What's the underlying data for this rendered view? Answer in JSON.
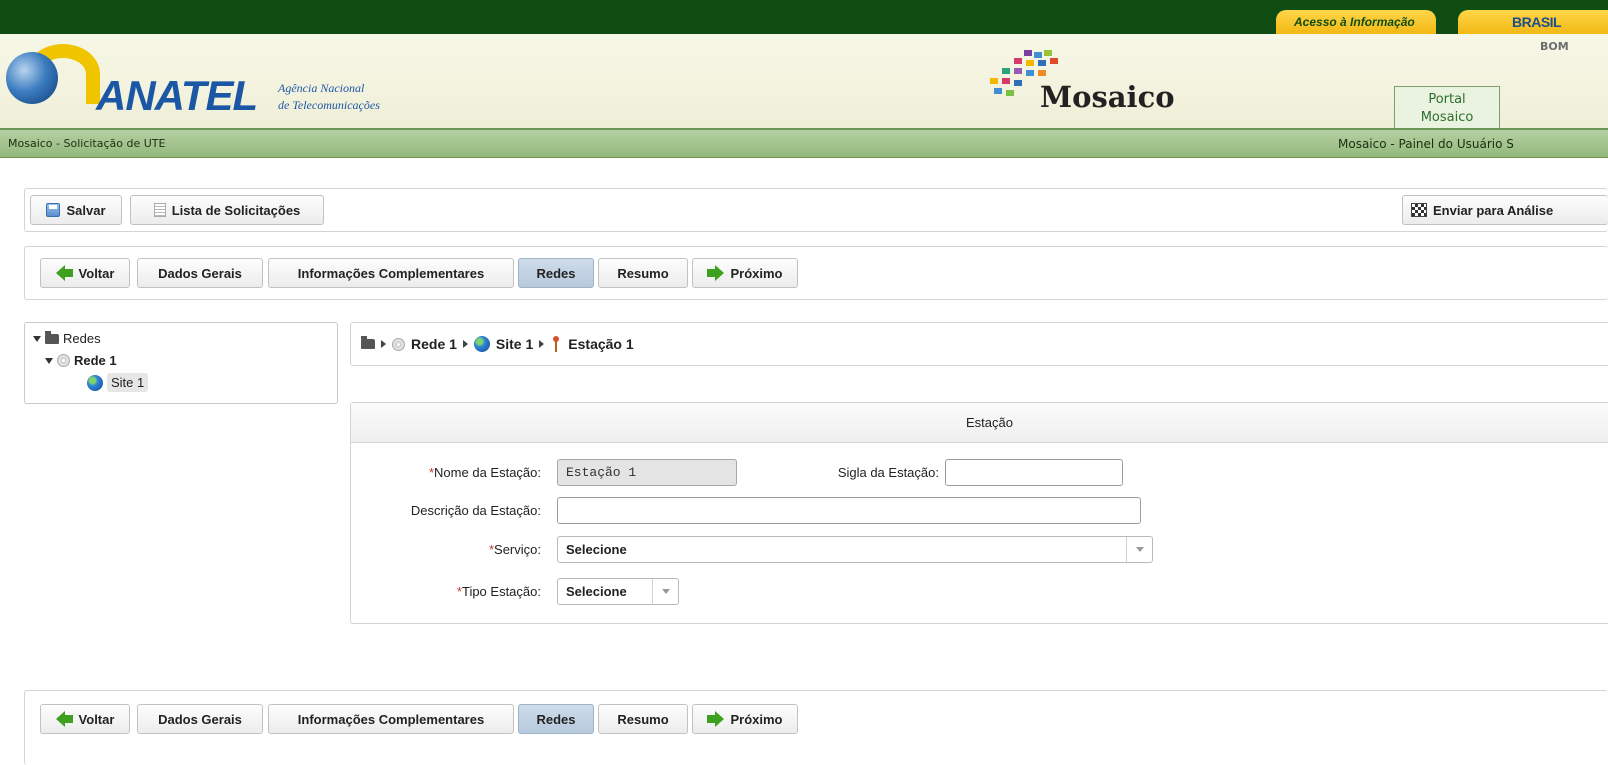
{
  "gov": {
    "acesso": "Acesso à Informação",
    "brasil": "BRASIL"
  },
  "header": {
    "logo_text": "ANATEL",
    "logo_sub_1": "Agência Nacional",
    "logo_sub_2": "de Telecomunicações",
    "app_title": "Mosaico",
    "portal_tab_1": "Portal",
    "portal_tab_2": "Mosaico",
    "bom": "BOM"
  },
  "nav": {
    "left": "Mosaico - Solicitação de UTE",
    "right": "Mosaico - Painel do Usuário   S"
  },
  "toolbar": {
    "save_label": "Salvar",
    "list_label": "Lista de Solicitações",
    "send_label": "Enviar para Análise"
  },
  "steps": {
    "back": "Voltar",
    "general": "Dados Gerais",
    "complementary": "Informações Complementares",
    "networks": "Redes",
    "summary": "Resumo",
    "next": "Próximo",
    "active": "Redes"
  },
  "tree": {
    "root": "Redes",
    "network": "Rede 1",
    "site": "Site 1"
  },
  "breadcrumb": {
    "network": "Rede 1",
    "site": "Site 1",
    "station": "Estação 1"
  },
  "form": {
    "title": "Estação",
    "station_name_label": "Nome da Estação:",
    "station_name_value": "Estação 1",
    "acronym_label": "Sigla da Estação:",
    "acronym_value": "",
    "description_label": "Descrição da Estação:",
    "description_value": "",
    "service_label": "Serviço:",
    "service_value": "Selecione",
    "type_label": "Tipo Estação:",
    "type_value": "Selecione",
    "required_mark": "*"
  },
  "colors": {
    "gov_green": "#0f4d13",
    "anatel_blue": "#1c57a5",
    "active_step": "#b6c9dc",
    "arrow_green": "#3ea01f",
    "required_red": "#c0392b"
  }
}
